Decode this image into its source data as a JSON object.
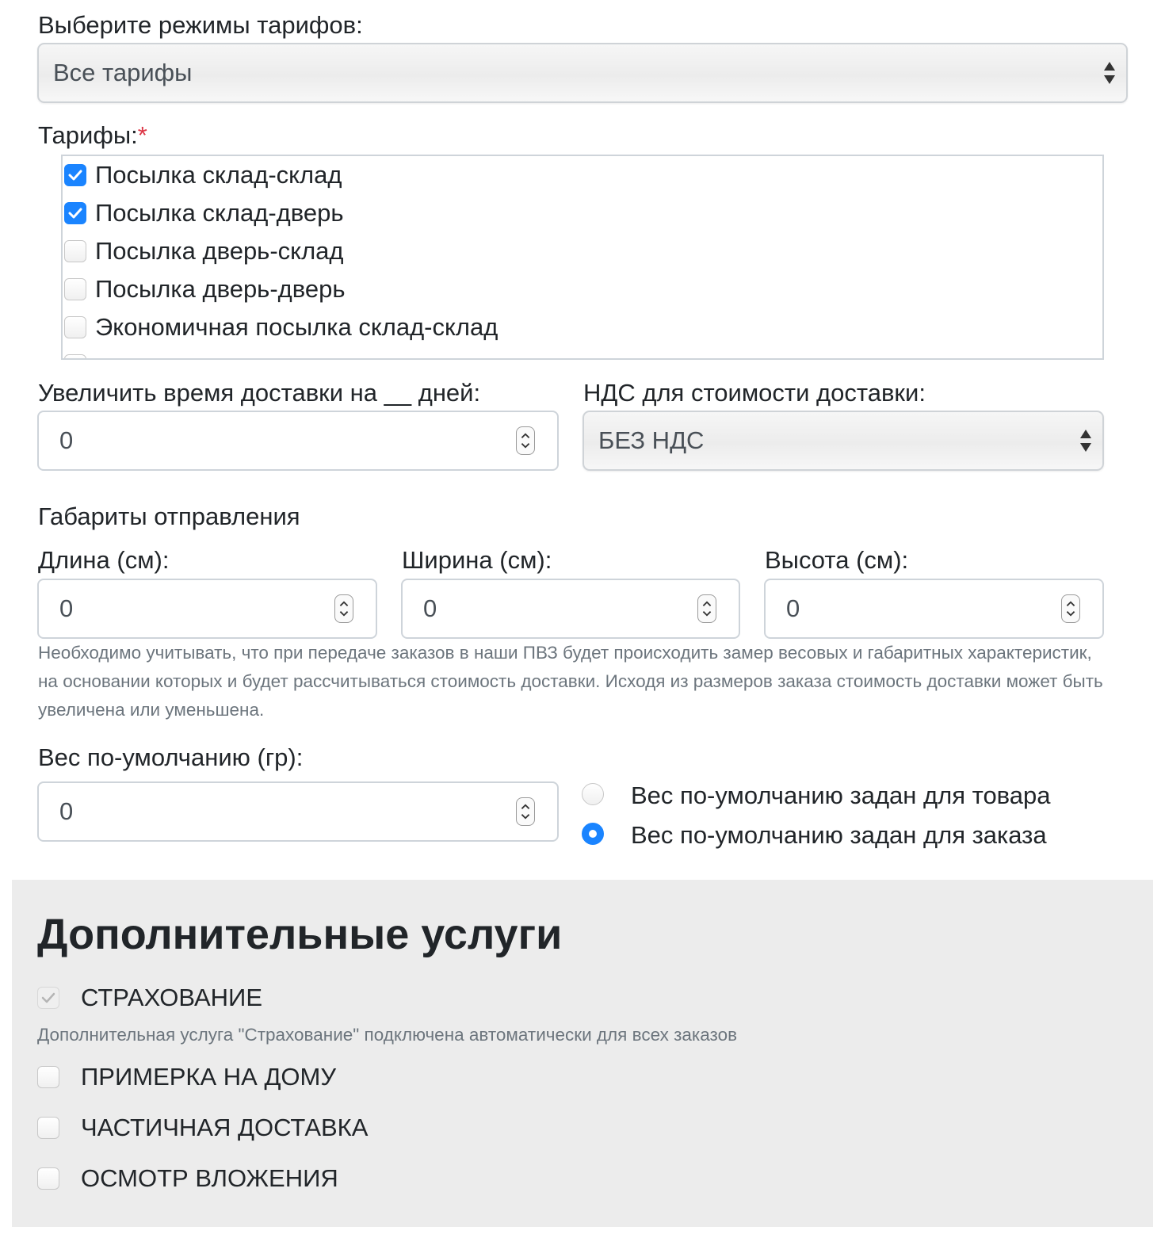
{
  "tariff_mode": {
    "label": "Выберите режимы тарифов:",
    "selected": "Все тарифы"
  },
  "tariffs": {
    "label": "Тарифы:",
    "required_mark": "*",
    "items": [
      {
        "label": "Посылка склад-склад",
        "checked": true
      },
      {
        "label": "Посылка склад-дверь",
        "checked": true
      },
      {
        "label": "Посылка дверь-склад",
        "checked": false
      },
      {
        "label": "Посылка дверь-дверь",
        "checked": false
      },
      {
        "label": "Экономичная посылка склад-склад",
        "checked": false
      }
    ]
  },
  "delivery_days": {
    "label": "Увеличить время доставки на __ дней:",
    "value": "0"
  },
  "vat": {
    "label": "НДС для стоимости доставки:",
    "selected": "БЕЗ НДС"
  },
  "dimensions": {
    "title": "Габариты отправления",
    "length": {
      "label": "Длина (см):",
      "value": "0"
    },
    "width": {
      "label": "Ширина (см):",
      "value": "0"
    },
    "height": {
      "label": "Высота (см):",
      "value": "0"
    },
    "help": "Необходимо учитывать, что при передаче заказов в наши ПВЗ будет происходить замер весовых и габаритных характеристик, на основании которых и будет рассчитываться стоимость доставки. Исходя из размеров заказа стоимость доставки может быть увеличена или уменьшена."
  },
  "weight": {
    "label": "Вес по-умолчанию (гр):",
    "value": "0",
    "options": [
      {
        "label": "Вес по-умолчанию задан для товара",
        "checked": false
      },
      {
        "label": "Вес по-умолчанию задан для заказа",
        "checked": true
      }
    ]
  },
  "extra_services": {
    "title": "Дополнительные услуги",
    "insurance": {
      "label": "СТРАХОВАНИЕ",
      "checked": true,
      "disabled": true,
      "help": "Дополнительная услуга \"Страхование\" подключена автоматически для всех заказов"
    },
    "items": [
      {
        "label": "ПРИМЕРКА НА ДОМУ",
        "checked": false
      },
      {
        "label": "ЧАСТИЧНАЯ ДОСТАВКА",
        "checked": false
      },
      {
        "label": "ОСМОТР ВЛОЖЕНИЯ",
        "checked": false
      }
    ]
  },
  "colors": {
    "accent": "#1a84ff",
    "required": "#dc3545",
    "panel_bg": "#ececec",
    "muted_text": "#6c757d"
  }
}
